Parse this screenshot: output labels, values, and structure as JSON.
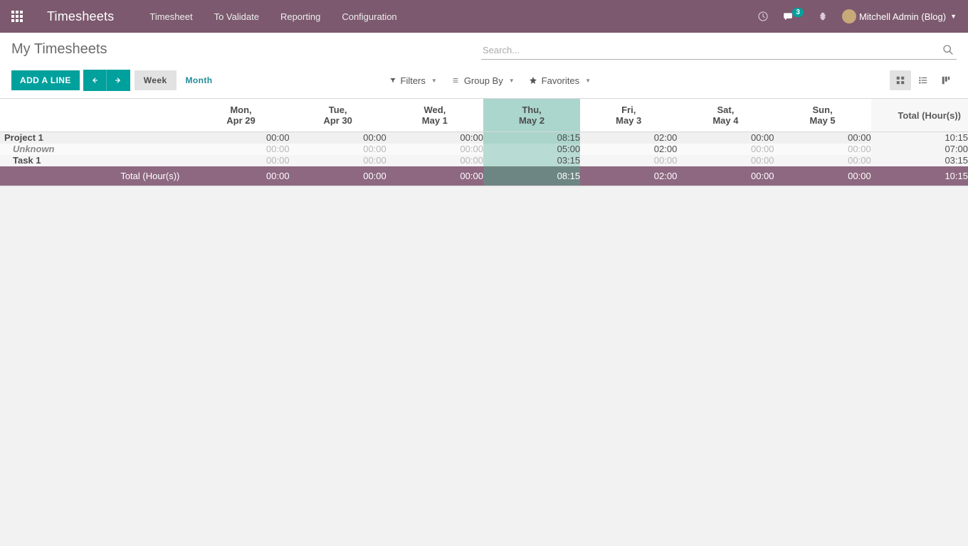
{
  "header": {
    "brand": "Timesheets",
    "nav": [
      "Timesheet",
      "To Validate",
      "Reporting",
      "Configuration"
    ],
    "messages_badge": "3",
    "user": "Mitchell Admin (Blog)"
  },
  "page": {
    "title": "My Timesheets",
    "search_placeholder": "Search...",
    "add_line": "Add a Line",
    "period_week": "Week",
    "period_month": "Month"
  },
  "filters": {
    "filters_label": "Filters",
    "groupby_label": "Group By",
    "favorites_label": "Favorites"
  },
  "grid": {
    "days": [
      {
        "dow": "Mon,",
        "date": "Apr 29",
        "today": false
      },
      {
        "dow": "Tue,",
        "date": "Apr 30",
        "today": false
      },
      {
        "dow": "Wed,",
        "date": "May 1",
        "today": false
      },
      {
        "dow": "Thu,",
        "date": "May 2",
        "today": true
      },
      {
        "dow": "Fri,",
        "date": "May 3",
        "today": false
      },
      {
        "dow": "Sat,",
        "date": "May 4",
        "today": false
      },
      {
        "dow": "Sun,",
        "date": "May 5",
        "today": false
      }
    ],
    "total_header": "Total (Hour(s))",
    "group": {
      "label": "Project 1",
      "cells": [
        "00:00",
        "00:00",
        "00:00",
        "08:15",
        "02:00",
        "00:00",
        "00:00"
      ],
      "cell_muted": [
        false,
        false,
        false,
        false,
        false,
        false,
        false
      ],
      "total": "10:15"
    },
    "rows": [
      {
        "label": "Unknown",
        "italic": true,
        "cells": [
          "00:00",
          "00:00",
          "00:00",
          "05:00",
          "02:00",
          "00:00",
          "00:00"
        ],
        "cell_muted": [
          true,
          true,
          true,
          false,
          false,
          true,
          true
        ],
        "total": "07:00"
      },
      {
        "label": "Task 1",
        "italic": false,
        "cells": [
          "00:00",
          "00:00",
          "00:00",
          "03:15",
          "00:00",
          "00:00",
          "00:00"
        ],
        "cell_muted": [
          true,
          true,
          true,
          false,
          true,
          true,
          true
        ],
        "total": "03:15"
      }
    ],
    "totals": {
      "label": "Total (Hour(s))",
      "cells": [
        "00:00",
        "00:00",
        "00:00",
        "08:15",
        "02:00",
        "00:00",
        "00:00"
      ],
      "grand": "10:15"
    }
  }
}
